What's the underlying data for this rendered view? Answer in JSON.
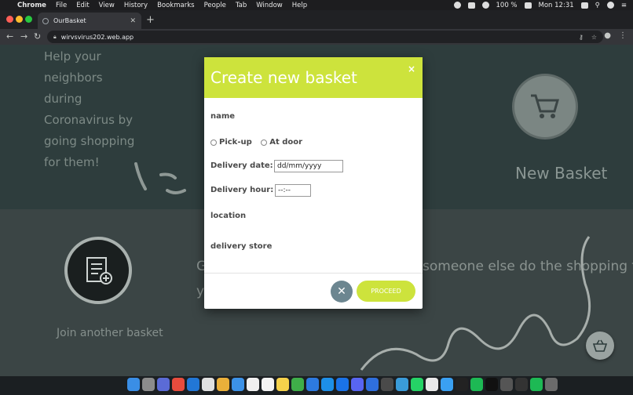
{
  "menubar": {
    "app": "Chrome",
    "items": [
      "File",
      "Edit",
      "View",
      "History",
      "Bookmarks",
      "People",
      "Tab",
      "Window",
      "Help"
    ],
    "battery": "100 %",
    "clock": "Mon 12:31"
  },
  "browser": {
    "tab_title": "OurBasket",
    "url": "wirvsvirus202.web.app"
  },
  "page": {
    "tagline": "Help your neighbors during Coronavirus by going shopping for them!",
    "new_basket_label": "New Basket",
    "join_label": "Join another basket",
    "bg_text_right": "someone else do the shopping for",
    "bg_text_left_1": "G",
    "bg_text_left_2": "y"
  },
  "modal": {
    "title": "Create new basket",
    "close_label": "×",
    "name_label": "name",
    "pickup_label": "Pick-up",
    "atdoor_label": "At door",
    "date_label": "Delivery date:",
    "date_placeholder": "dd/mm/yyyy",
    "hour_label": "Delivery hour:",
    "hour_placeholder": "--:--",
    "location_label": "location",
    "store_label": "delivery store",
    "cancel_label": "✕",
    "proceed_label": "PROCEED"
  },
  "colors": {
    "accent": "#cde33c",
    "cancel_button": "#6c8690",
    "top_band": "#2e3d3d",
    "bottom_band": "#3b4545"
  },
  "icons": {
    "cart": "shopping-cart-icon",
    "join": "list-add-icon",
    "fab": "basket-icon"
  }
}
